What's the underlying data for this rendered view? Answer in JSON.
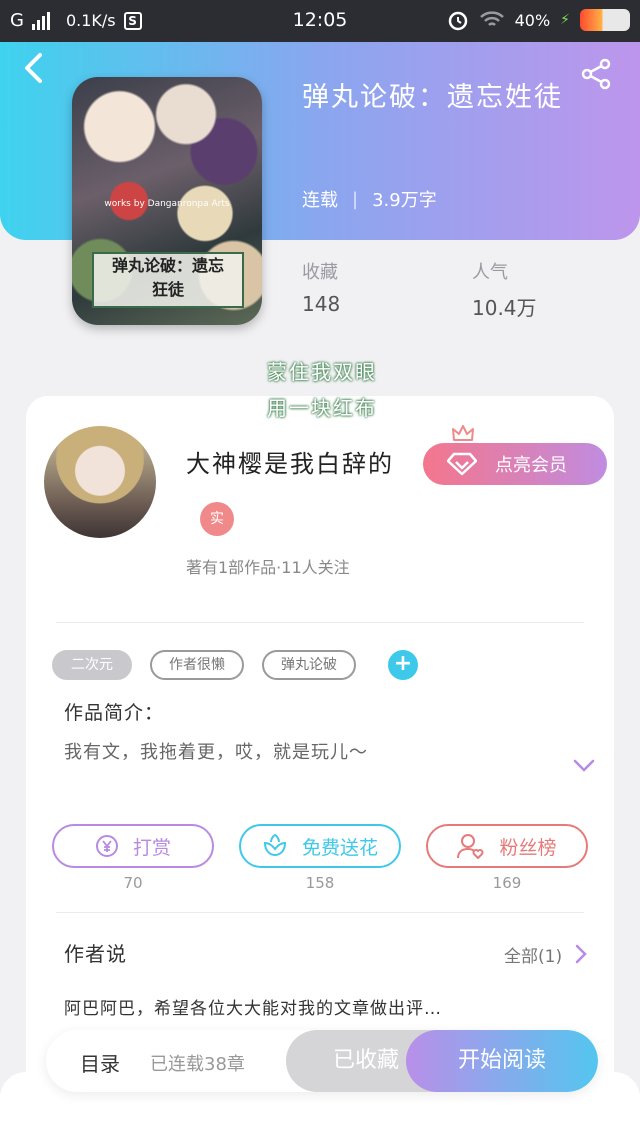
{
  "status_bar": {
    "carrier": "G",
    "speed": "0.1K/s",
    "s_badge": "S",
    "time": "12:05",
    "battery": "40%"
  },
  "book": {
    "title": "弹丸论破：遗忘姓徒",
    "status": "连载",
    "word_count": "3.9万字",
    "stats": [
      {
        "label": "收藏",
        "value": "148"
      },
      {
        "label": "人气",
        "value": "10.4万"
      }
    ],
    "cover": {
      "title_line1": "弹丸论破：遗忘",
      "title_line2": "狂徒",
      "credit": "works by Danganronpa Arts"
    }
  },
  "overlay": {
    "line1": "蒙住我双眼",
    "line2": "用一块红布"
  },
  "author": {
    "name": "大神樱是我白辞的",
    "badge": "实",
    "meta": "著有1部作品·11人关注",
    "vip_button": "点亮会员"
  },
  "tags": [
    {
      "label": "二次元",
      "style": "gray"
    },
    {
      "label": "作者很懒",
      "style": "outline"
    },
    {
      "label": "弹丸论破",
      "style": "outline"
    }
  ],
  "add_tag": "+",
  "intro": {
    "title": "作品简介：",
    "text": "我有文，我拖着更，哎，就是玩儿～"
  },
  "actions": [
    {
      "label": "打赏",
      "icon": "yen-coin-icon",
      "count": "70",
      "color": "#b78be3"
    },
    {
      "label": "免费送花",
      "icon": "flower-icon",
      "count": "158",
      "color": "#3ec9ea"
    },
    {
      "label": "粉丝榜",
      "icon": "fan-user-icon",
      "count": "169",
      "color": "#e67a7a"
    }
  ],
  "author_say": {
    "title": "作者说",
    "all": "全部(1)",
    "text": "阿巴阿巴，希望各位大大能对我的文章做出评…"
  },
  "bottom": {
    "toc": "目录",
    "toc_count": "已连载38章",
    "collected": "已收藏",
    "read": "开始阅读"
  }
}
